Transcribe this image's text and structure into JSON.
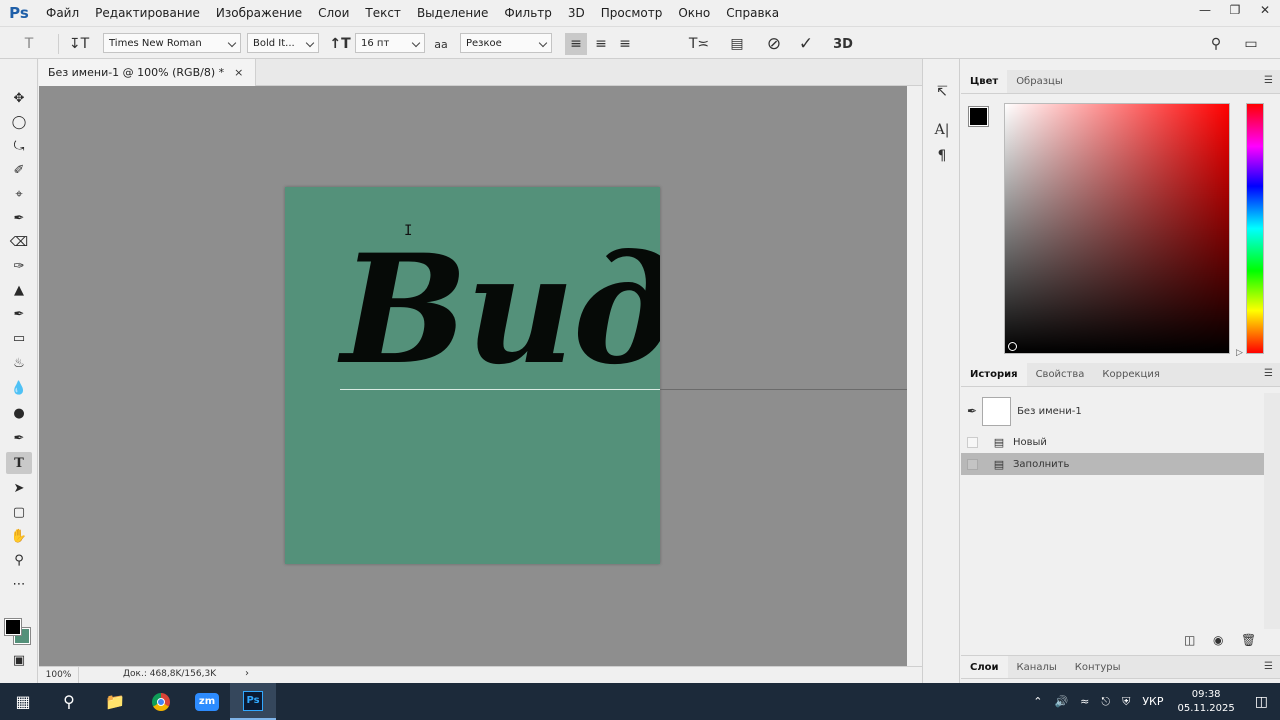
{
  "app": {
    "logo": "Ps"
  },
  "menu": [
    "Файл",
    "Редактирование",
    "Изображение",
    "Слои",
    "Текст",
    "Выделение",
    "Фильтр",
    "3D",
    "Просмотр",
    "Окно",
    "Справка"
  ],
  "options": {
    "font_family": "Times New Roman",
    "font_style": "Bold It...",
    "font_size": "16 пт",
    "antialias": "Резкое",
    "three_d": "3D",
    "text_color": "#000000"
  },
  "document": {
    "tab_title": "Без имени-1 @ 100% (RGB/8) *",
    "close": "×",
    "canvas_text": "Вид",
    "canvas_color": "#54917a"
  },
  "status": {
    "zoom": "100%",
    "doc_size": "Док.: 468,8K/156,3K"
  },
  "color_panel": {
    "tabs": [
      "Цвет",
      "Образцы"
    ],
    "foreground": "#000000",
    "background": "#54917a"
  },
  "history_panel": {
    "tabs": [
      "История",
      "Свойства",
      "Коррекция"
    ],
    "snapshot": "Без имени-1",
    "items": [
      {
        "label": "Новый",
        "selected": false
      },
      {
        "label": "Заполнить",
        "selected": true
      }
    ]
  },
  "layers_panel": {
    "tabs": [
      "Слои",
      "Каналы",
      "Контуры"
    ]
  },
  "taskbar": {
    "zoom_app": "zm",
    "ps_app": "Ps",
    "language": "УКР",
    "time": "09:38",
    "date": "05.11.2025"
  }
}
